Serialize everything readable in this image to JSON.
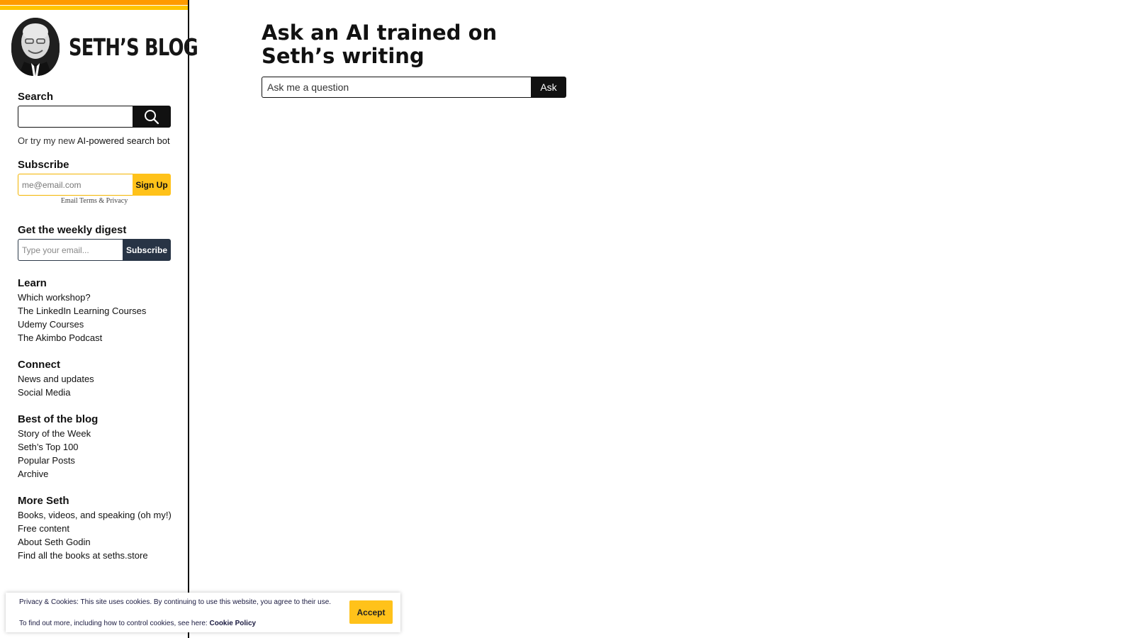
{
  "brand": {
    "title": "SETH’S BLOG"
  },
  "search": {
    "heading": "Search",
    "ai_prefix": "Or try my new",
    "ai_link": "AI-powered search bot"
  },
  "subscribe": {
    "heading": "Subscribe",
    "placeholder": "me@email.com",
    "button": "Sign Up",
    "terms": "Email Terms & Privacy",
    "accent": "#ffc21a"
  },
  "digest": {
    "heading": "Get the weekly digest",
    "placeholder": "Type your email...",
    "button": "Subscribe",
    "accent": "#283445"
  },
  "learn": {
    "heading": "Learn",
    "items": [
      "Which workshop?",
      "The LinkedIn Learning Courses",
      "Udemy Courses",
      "The Akimbo Podcast"
    ]
  },
  "connect": {
    "heading": "Connect",
    "items": [
      "News and updates",
      "Social Media"
    ]
  },
  "best": {
    "heading": "Best of the blog",
    "items": [
      "Story of the Week",
      "Seth’s Top 100",
      "Popular Posts",
      "Archive"
    ]
  },
  "more": {
    "heading": "More Seth",
    "items": [
      "Books, videos, and speaking (oh my!)",
      "Free content",
      "About Seth Godin",
      "Find all the books at seths.store"
    ]
  },
  "main": {
    "title": "Ask an AI trained on Seth’s writing",
    "placeholder": "Ask me a question",
    "button": "Ask"
  },
  "cookie": {
    "line1": "Privacy & Cookies: This site uses cookies. By continuing to use this website, you agree to their use.",
    "line2": "To find out more, including how to control cookies, see here:",
    "policy_link": "Cookie Policy",
    "accept": "Accept"
  },
  "icons": {
    "search": "magnifier-icon",
    "avatar": "seth-portrait"
  }
}
